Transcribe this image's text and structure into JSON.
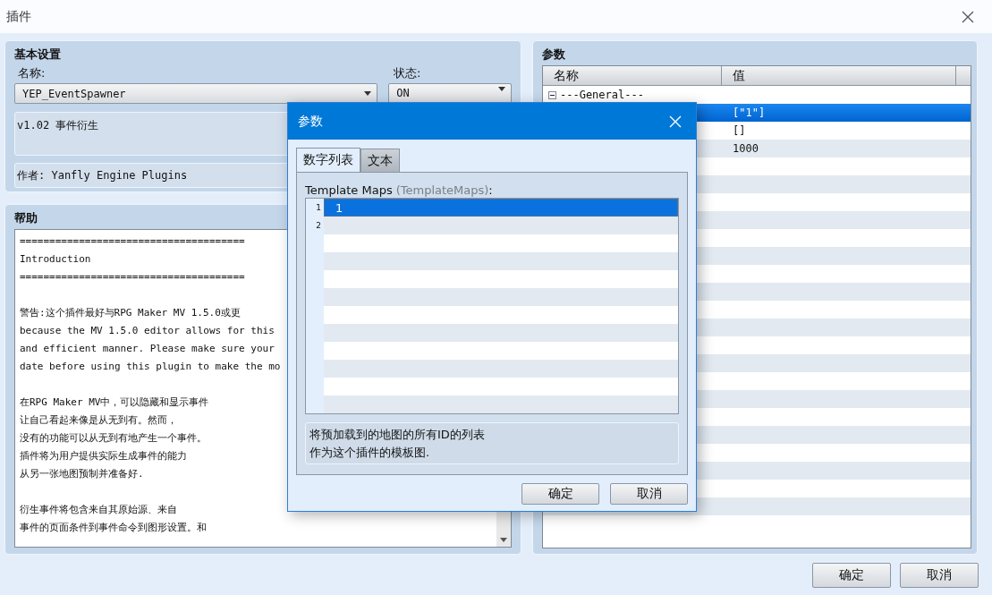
{
  "window": {
    "title": "插件"
  },
  "basic_settings": {
    "title": "基本设置",
    "name_label": "名称:",
    "name_value": "YEP_EventSpawner",
    "status_label": "状态:",
    "status_value": "ON",
    "description": "v1.02 事件衍生",
    "author": "作者: Yanfly Engine Plugins"
  },
  "help": {
    "title": "帮助",
    "paragraphs": [
      [
        "======================================",
        "Introduction",
        "======================================"
      ],
      [
        "警告:这个插件最好与RPG Maker MV 1.5.0或更",
        "because the MV 1.5.0 editor allows for this",
        "and efficient manner. Please make sure your",
        "date before using this plugin to make the mo"
      ],
      [
        "在RPG Maker MV中，可以隐藏和显示事件",
        "让自己看起来像是从无到有。然而，",
        "没有的功能可以从无到有地产生一个事件。",
        "插件将为用户提供实际生成事件的能力",
        "从另一张地图预制并准备好."
      ],
      [
        "衍生事件将包含来自其原始源、来自",
        "事件的页面条件到事件命令到图形设置。和"
      ]
    ]
  },
  "parameters": {
    "title": "参数",
    "columns": [
      "名称",
      "值"
    ],
    "rows": [
      {
        "kind": "group",
        "name": "---General---",
        "expanded": true,
        "selected": false
      },
      {
        "kind": "param",
        "value": "[\"1\"]",
        "selected": true
      },
      {
        "kind": "param",
        "value": "[]",
        "selected": false
      },
      {
        "kind": "param",
        "value": "1000",
        "selected": false
      }
    ]
  },
  "dialog": {
    "title": "参数",
    "tabs": [
      {
        "label": "数字列表",
        "selected": true
      },
      {
        "label": "文本",
        "selected": false
      }
    ],
    "field_label": "Template Maps",
    "field_key": "(TemplateMaps)",
    "field_label_end": ":",
    "list": [
      {
        "number": "1",
        "value": "1",
        "selected": true
      },
      {
        "number": "2",
        "selected": false
      }
    ],
    "description": [
      "将预加载到的地图的所有ID的列表",
      "作为这个插件的模板图."
    ],
    "buttons": [
      "确定",
      "取消"
    ]
  },
  "buttons": [
    "确定",
    "取消"
  ]
}
